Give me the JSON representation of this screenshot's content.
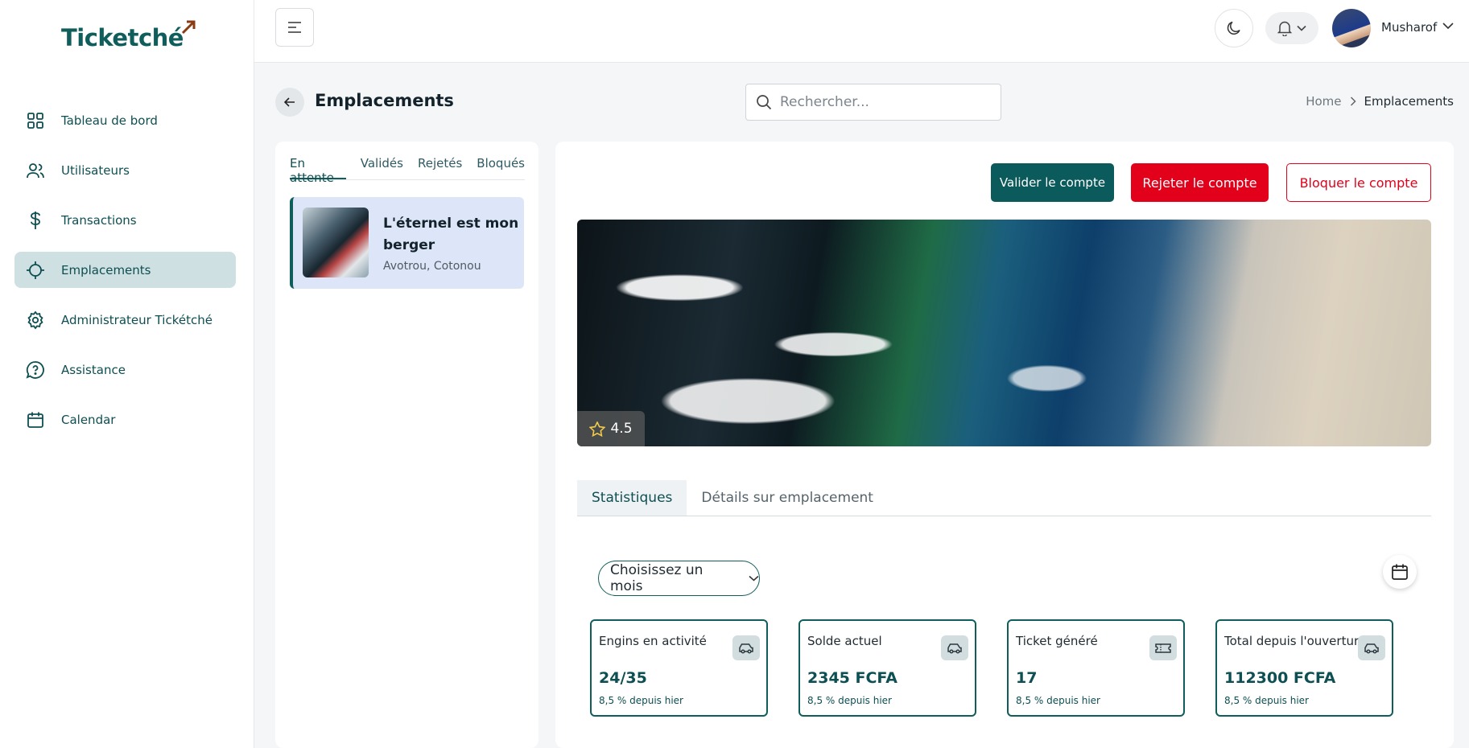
{
  "brand": {
    "name": "Ticketché"
  },
  "sidebar": {
    "items": [
      {
        "label": "Tableau de bord",
        "icon": "dashboard-grid-icon"
      },
      {
        "label": "Utilisateurs",
        "icon": "users-icon"
      },
      {
        "label": "Transactions",
        "icon": "dollar-icon"
      },
      {
        "label": "Emplacements",
        "icon": "location-crosshair-icon",
        "active": true
      },
      {
        "label": "Administrateur Tickétché",
        "icon": "gear-icon"
      },
      {
        "label": "Assistance",
        "icon": "help-chat-icon"
      },
      {
        "label": "Calendar",
        "icon": "calendar-icon"
      }
    ]
  },
  "header": {
    "user_name": "Musharof"
  },
  "page": {
    "title": "Emplacements",
    "search_placeholder": "Rechercher...",
    "breadcrumb": {
      "home": "Home",
      "current": "Emplacements"
    }
  },
  "list": {
    "tabs": [
      "En attente",
      "Validés",
      "Rejetés",
      "Bloqués"
    ],
    "active_tab": "En attente",
    "items": [
      {
        "title": "L'éternel est mon berger",
        "subtitle": "Avotrou, Cotonou"
      }
    ]
  },
  "detail": {
    "actions": {
      "validate": "Valider le compte",
      "reject": "Rejeter le compte",
      "block": "Bloquer le compte"
    },
    "rating": "4.5",
    "tabs": [
      "Statistiques",
      "Détails sur emplacement"
    ],
    "active_tab": "Statistiques",
    "month_select": "Choisissez un mois",
    "stats": [
      {
        "label": "Engins en activité",
        "value": "24/35",
        "change": "8,5 % depuis hier",
        "icon": "car-icon"
      },
      {
        "label": "Solde actuel",
        "value": "2345 FCFA",
        "change": "8,5 % depuis hier",
        "icon": "car-icon"
      },
      {
        "label": "Ticket généré",
        "value": "17",
        "change": "8,5 % depuis hier",
        "icon": "ticket-icon"
      },
      {
        "label": "Total depuis l'ouverture",
        "value": "112300 FCFA",
        "change": "8,5 % depuis hier",
        "icon": "car-icon"
      }
    ]
  },
  "colors": {
    "primary": "#0f5e5c",
    "danger": "#e3001b",
    "active_nav_bg": "#cfe0e2",
    "logo_arrow": "#8a3b12"
  }
}
